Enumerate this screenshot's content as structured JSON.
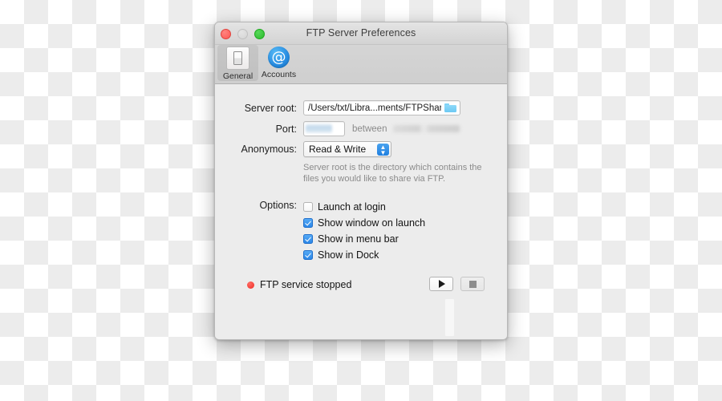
{
  "window": {
    "title": "FTP Server Preferences",
    "traffic_lights": [
      {
        "name": "close",
        "color": "#fc5753"
      },
      {
        "name": "minimize",
        "color": "#d4d4d4"
      },
      {
        "name": "zoom",
        "color": "#2dbb2d"
      }
    ]
  },
  "toolbar": {
    "items": [
      {
        "label": "General",
        "icon": "switch-icon",
        "selected": true
      },
      {
        "label": "Accounts",
        "icon": "at-sign-icon",
        "selected": false
      }
    ]
  },
  "form": {
    "server_root": {
      "label": "Server root:",
      "value": "/Users/txt/Libra...ments/FTPShare",
      "browse_icon": "folder-icon"
    },
    "port": {
      "label": "Port:",
      "value": "",
      "between_label": "between",
      "range_value": ""
    },
    "anonymous": {
      "label": "Anonymous:",
      "value": "Read & Write",
      "options": [
        "Read & Write"
      ]
    },
    "help_text": "Server root is the directory which contains the files you would like to share via FTP."
  },
  "options": {
    "label": "Options:",
    "items": [
      {
        "label": "Launch at login",
        "checked": false
      },
      {
        "label": "Show window on launch",
        "checked": true
      },
      {
        "label": "Show in menu bar",
        "checked": true
      },
      {
        "label": "Show in Dock",
        "checked": true
      }
    ]
  },
  "status": {
    "text": "FTP service stopped",
    "dot_color": "#ee2d24",
    "start_button": {
      "name": "play",
      "enabled": true
    },
    "stop_button": {
      "name": "stop",
      "enabled": false
    }
  },
  "colors": {
    "accent": "#2b87e8",
    "window_bg": "#ececec",
    "titlebar": "#d3d3d3",
    "toolbar": "#cfcfcf"
  }
}
